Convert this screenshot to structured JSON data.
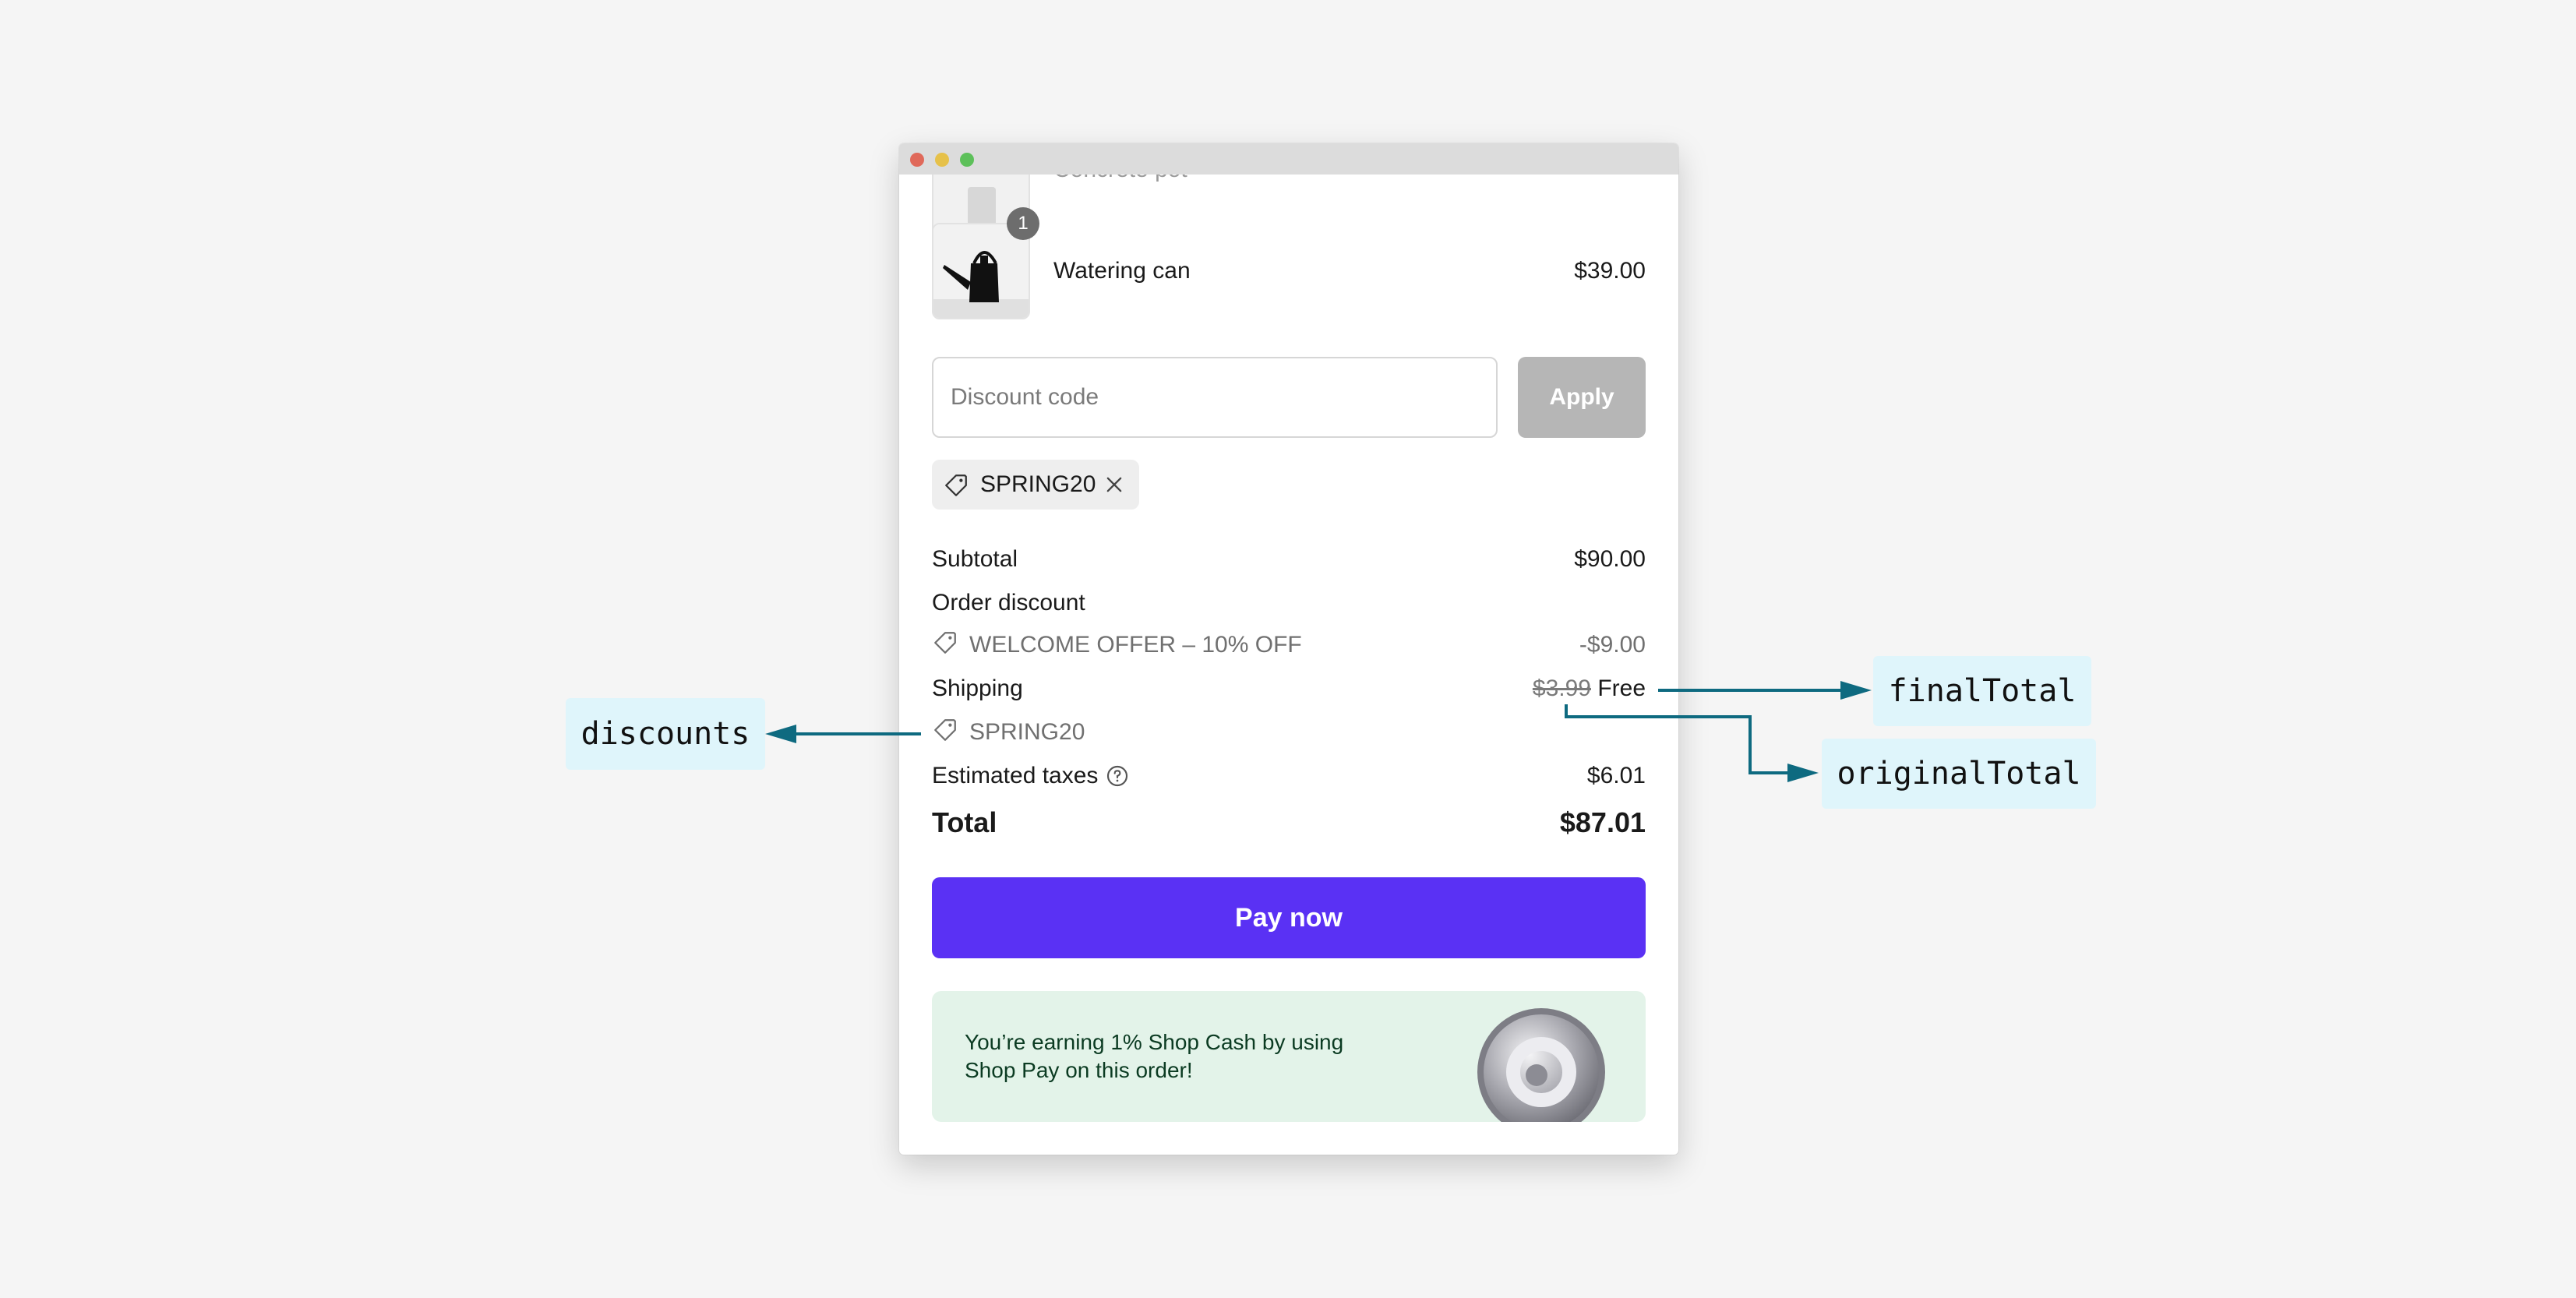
{
  "colors": {
    "accent": "#5a31f4",
    "annotation_arrow": "#0e6a80",
    "annotation_bg": "#dff5fb",
    "shop_cash_bg": "#e3f3e9"
  },
  "cart": {
    "items": [
      {
        "name": "Concrete pot",
        "quantity": "",
        "price": ""
      },
      {
        "name": "Watering can",
        "quantity": "1",
        "price": "$39.00"
      }
    ]
  },
  "discount": {
    "placeholder": "Discount code",
    "value": "",
    "apply_label": "Apply",
    "applied_code": "SPRING20",
    "tag_icon": "tag-icon",
    "remove_icon": "close-icon"
  },
  "summary": {
    "subtotal_label": "Subtotal",
    "subtotal_value": "$90.00",
    "order_discount_label": "Order discount",
    "order_discount_name": "WELCOME OFFER – 10% OFF",
    "order_discount_value": "-$9.00",
    "shipping_label": "Shipping",
    "shipping_original": "$3.99",
    "shipping_final": "Free",
    "shipping_discount_code": "SPRING20",
    "taxes_label": "Estimated taxes",
    "taxes_help_icon": "help-icon",
    "taxes_value": "$6.01",
    "total_label": "Total",
    "total_value": "$87.01"
  },
  "pay_button_label": "Pay now",
  "shop_cash": {
    "line1": "You’re earning 1% Shop Cash by using",
    "line2": "Shop Pay on this order!",
    "coin_icon": "shop-cash-coin-icon"
  },
  "annotations": {
    "discounts": "discounts",
    "final_total": "finalTotal",
    "original_total": "originalTotal"
  }
}
